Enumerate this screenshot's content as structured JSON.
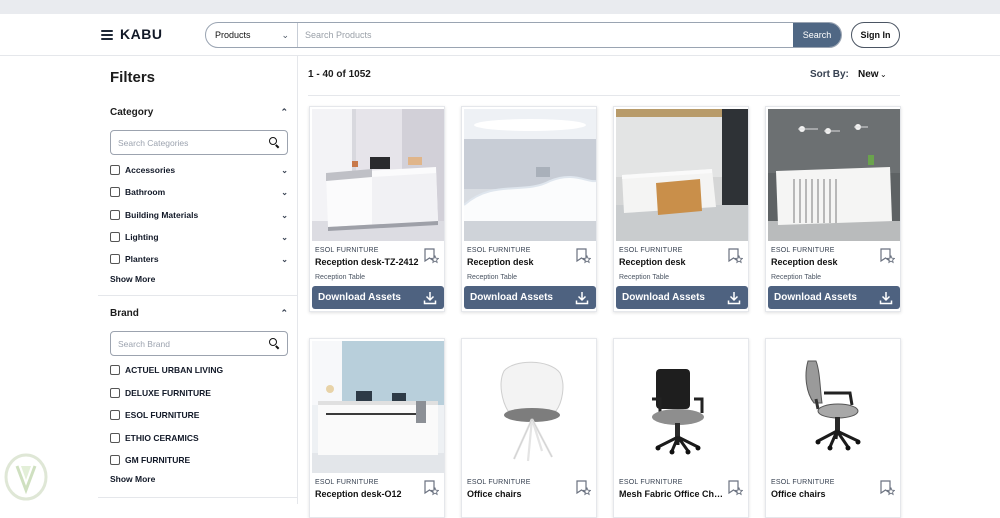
{
  "header": {
    "brand": "KABU",
    "search_category": "Products",
    "search_placeholder": "Search Products",
    "search_button": "Search",
    "signin_button": "Sign In"
  },
  "sidebar": {
    "title": "Filters",
    "category": {
      "heading": "Category",
      "search_placeholder": "Search Categories",
      "items": [
        {
          "label": "Accessories"
        },
        {
          "label": "Bathroom"
        },
        {
          "label": "Building Materials"
        },
        {
          "label": "Lighting"
        },
        {
          "label": "Planters"
        }
      ],
      "show_more": "Show More"
    },
    "brand": {
      "heading": "Brand",
      "search_placeholder": "Search Brand",
      "items": [
        {
          "label": "ACTUEL URBAN LIVING"
        },
        {
          "label": "DELUXE FURNITURE"
        },
        {
          "label": "ESOL FURNITURE"
        },
        {
          "label": "ETHIO CERAMICS"
        },
        {
          "label": "GM FURNITURE"
        }
      ],
      "show_more": "Show More"
    }
  },
  "results": {
    "count_text": "1 - 40 of 1052",
    "sort_label": "Sort By:",
    "sort_value": "New"
  },
  "products": [
    {
      "vendor": "ESOL FURNITURE",
      "title": "Reception desk-TZ-2412",
      "category": "Reception Table",
      "download": "Download Assets",
      "image": "reception-desk-white-gray-icon"
    },
    {
      "vendor": "ESOL FURNITURE",
      "title": "Reception desk",
      "category": "Reception Table",
      "download": "Download Assets",
      "image": "reception-desk-curved-white-icon"
    },
    {
      "vendor": "ESOL FURNITURE",
      "title": "Reception desk",
      "category": "Reception Table",
      "download": "Download Assets",
      "image": "reception-desk-marble-wood-icon"
    },
    {
      "vendor": "ESOL FURNITURE",
      "title": "Reception desk",
      "category": "Reception Table",
      "download": "Download Assets",
      "image": "reception-desk-gray-slats-icon"
    },
    {
      "vendor": "ESOL FURNITURE",
      "title": "Reception desk-O12",
      "category": "",
      "download": "",
      "image": "reception-desk-blue-wall-icon"
    },
    {
      "vendor": "ESOL FURNITURE",
      "title": "Office chairs",
      "category": "",
      "download": "",
      "image": "white-shell-chair-icon"
    },
    {
      "vendor": "ESOL FURNITURE",
      "title": "Mesh Fabric Office Chair",
      "category": "",
      "download": "",
      "image": "mesh-office-chair-icon"
    },
    {
      "vendor": "ESOL FURNITURE",
      "title": "Office chairs",
      "category": "",
      "download": "",
      "image": "gray-task-chair-icon"
    }
  ],
  "colors": {
    "accent": "#4e6280",
    "topstrip": "#e9ebef"
  }
}
